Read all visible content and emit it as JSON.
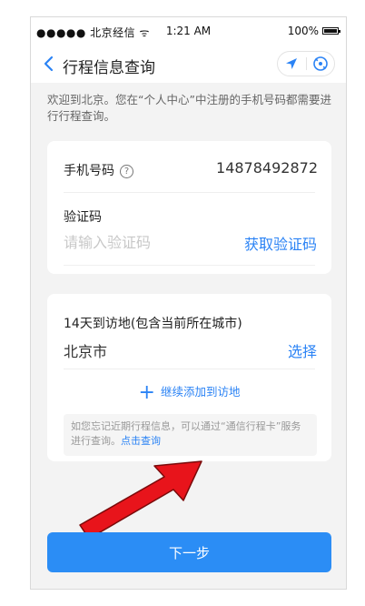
{
  "status_bar": {
    "carrier": "●●●●● 北京经信 ᯤ",
    "time": "1:21 AM",
    "battery": "100%"
  },
  "navbar": {
    "title": "行程信息查询",
    "location_icon": "navigation-arrow-icon",
    "close_icon": "circle-close-icon"
  },
  "welcome_text": "欢迎到北京。您在“个人中心”中注册的手机号码都需要进行行程查询。",
  "phone_section": {
    "label": "手机号码",
    "help_glyph": "?",
    "value": "14878492872"
  },
  "code_section": {
    "label": "验证码",
    "placeholder": "请输入验证码",
    "get_code": "获取验证码"
  },
  "visit_section": {
    "label": "14天到访地(包含当前所在城市)",
    "city": "北京市",
    "choose": "选择",
    "add_more": "继续添加到访地",
    "note_text": "如您忘记近期行程信息，可以通过“通信行程卡”服务进行查询。",
    "note_link": "点击查询"
  },
  "next_button": "下一步",
  "colors": {
    "accent": "#2b83f5",
    "button": "#2b8df5",
    "arrow": "#e8141b"
  }
}
